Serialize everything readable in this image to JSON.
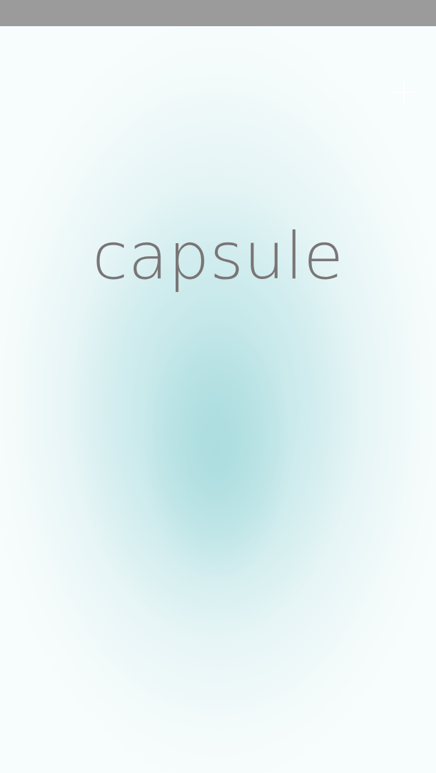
{
  "app": {
    "title": "capsule"
  },
  "toolbar": {
    "add_icon": "plus-icon"
  },
  "colors": {
    "status_bar": "#9b9b9b",
    "logo_text": "#7a7576",
    "background_center": "#b5e0e2",
    "background_edge": "#f7fcfc",
    "plus_icon": "#ffffff"
  }
}
